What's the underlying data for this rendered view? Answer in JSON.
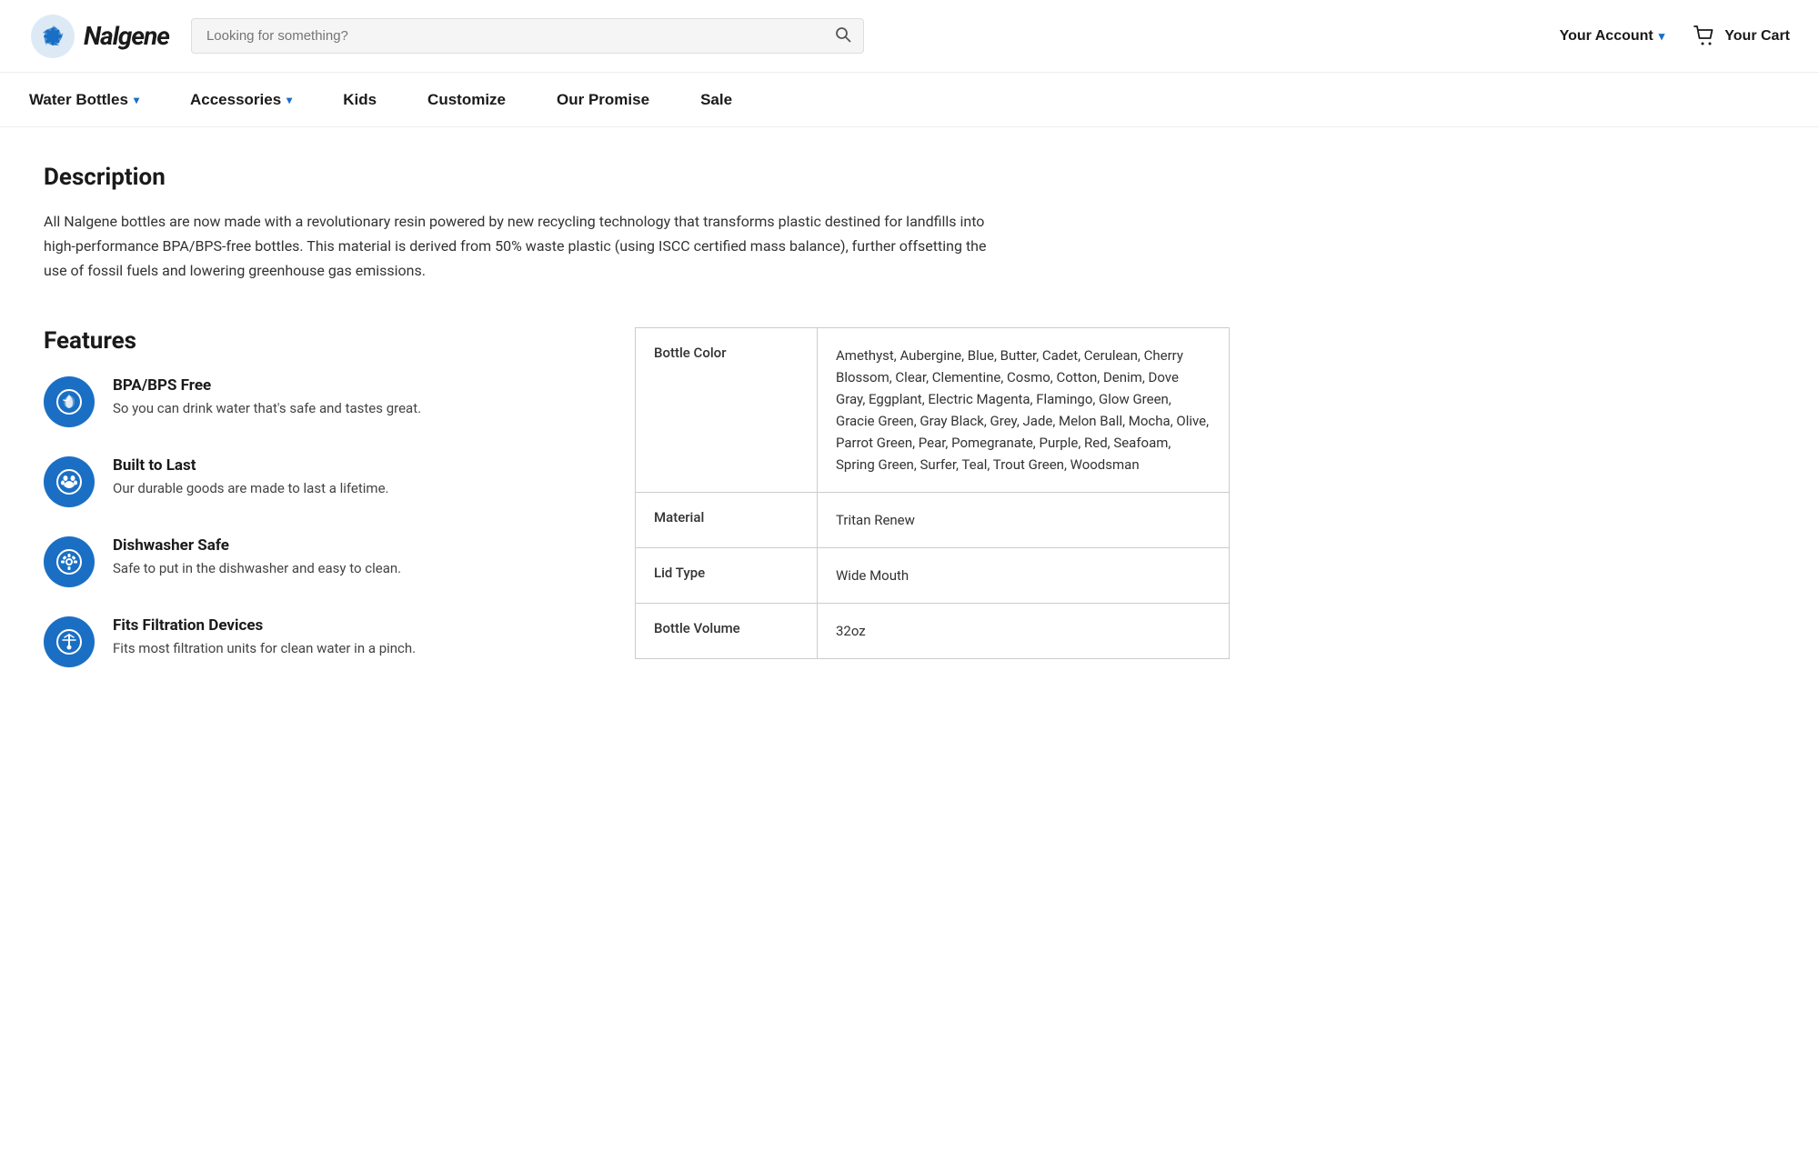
{
  "header": {
    "logo_alt": "Nalgene",
    "search_placeholder": "Looking for something?",
    "account_label": "Your Account",
    "cart_label": "Your Cart"
  },
  "nav": {
    "items": [
      {
        "label": "Water Bottles",
        "has_dropdown": true
      },
      {
        "label": "Accessories",
        "has_dropdown": true
      },
      {
        "label": "Kids",
        "has_dropdown": false
      },
      {
        "label": "Customize",
        "has_dropdown": false
      },
      {
        "label": "Our Promise",
        "has_dropdown": false
      },
      {
        "label": "Sale",
        "has_dropdown": false
      }
    ]
  },
  "description": {
    "title": "Description",
    "text": "All Nalgene bottles are now made with a revolutionary resin powered by new recycling technology that transforms plastic destined for landfills into high-performance BPA/BPS-free bottles. This material is derived from 50% waste plastic (using ISCC certified mass balance), further offsetting the use of fossil fuels and lowering greenhouse gas emissions."
  },
  "features": {
    "title": "Features",
    "items": [
      {
        "name": "BPA/BPS Free",
        "desc": "So you can drink water that's safe and tastes great.",
        "icon": "💧"
      },
      {
        "name": "Built to Last",
        "desc": "Our durable goods are made to last a lifetime.",
        "icon": "🐾"
      },
      {
        "name": "Dishwasher Safe",
        "desc": "Safe to put in the dishwasher and easy to clean.",
        "icon": "⚙"
      },
      {
        "name": "Fits Filtration Devices",
        "desc": "Fits most filtration units for clean water in a pinch.",
        "icon": "🔍"
      }
    ]
  },
  "specs": {
    "rows": [
      {
        "label": "Bottle Color",
        "value": "Amethyst, Aubergine, Blue, Butter, Cadet, Cerulean, Cherry Blossom, Clear, Clementine, Cosmo, Cotton, Denim, Dove Gray, Eggplant, Electric Magenta, Flamingo, Glow Green, Gracie Green, Gray Black, Grey, Jade, Melon Ball, Mocha, Olive, Parrot Green, Pear, Pomegranate, Purple, Red, Seafoam, Spring Green, Surfer, Teal, Trout Green, Woodsman"
      },
      {
        "label": "Material",
        "value": "Tritan Renew"
      },
      {
        "label": "Lid Type",
        "value": "Wide Mouth"
      },
      {
        "label": "Bottle Volume",
        "value": "32oz"
      }
    ]
  }
}
